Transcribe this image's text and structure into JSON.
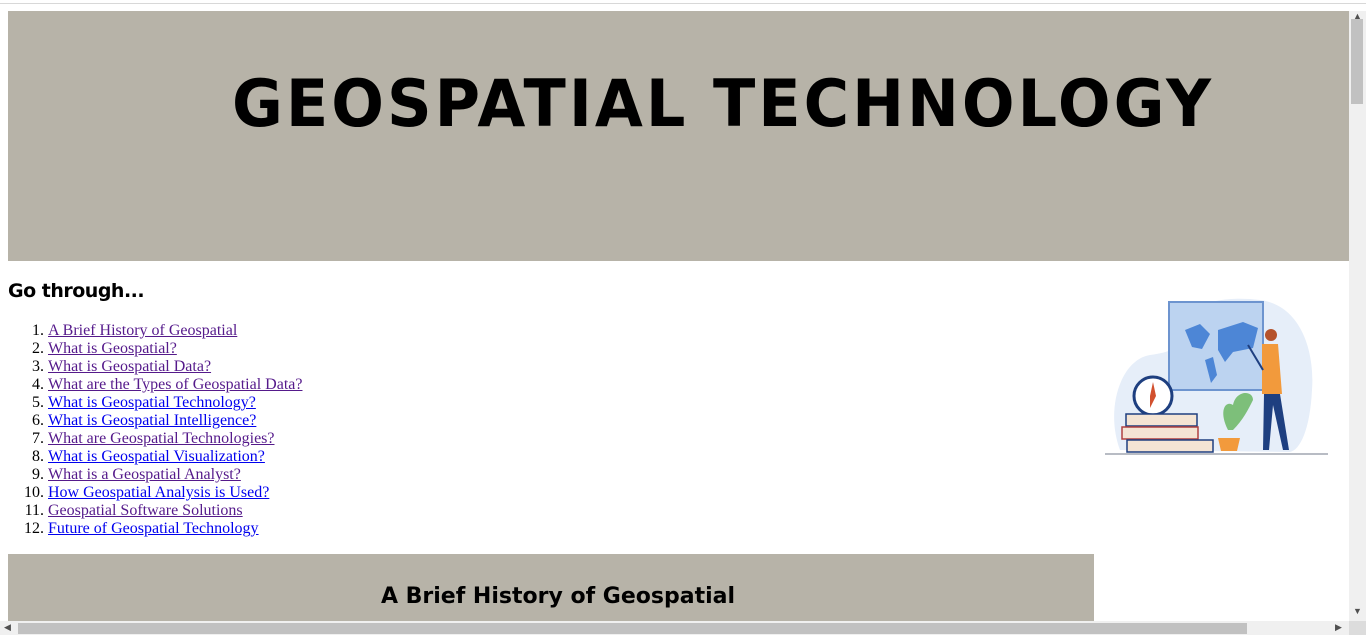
{
  "header": {
    "title": "GEOSPATIAL TECHNOLOGY"
  },
  "toc": {
    "heading": "Go through...",
    "items": [
      {
        "label": "A Brief History of Geospatial",
        "visited": true
      },
      {
        "label": "What is Geospatial?",
        "visited": true
      },
      {
        "label": "What is Geospatial Data?",
        "visited": true
      },
      {
        "label": "What are the Types of Geospatial Data?",
        "visited": true
      },
      {
        "label": "What is Geospatial Technology?",
        "visited": false
      },
      {
        "label": "What is Geospatial Intelligence?",
        "visited": false
      },
      {
        "label": "What are Geospatial Technologies?",
        "visited": true
      },
      {
        "label": "What is Geospatial Visualization?",
        "visited": false
      },
      {
        "label": "What is a Geospatial Analyst?",
        "visited": true
      },
      {
        "label": "How Geospatial Analysis is Used?",
        "visited": false
      },
      {
        "label": "Geospatial Software Solutions",
        "visited": true
      },
      {
        "label": "Future of Geospatial Technology",
        "visited": false
      }
    ]
  },
  "section": {
    "title": "A Brief History of Geospatial"
  },
  "colors": {
    "banner": "#b7b3a8",
    "link": "#0000ee",
    "visited_link": "#551a8b"
  },
  "illustration": {
    "icon": "person-pointing-at-world-map-illustration"
  }
}
